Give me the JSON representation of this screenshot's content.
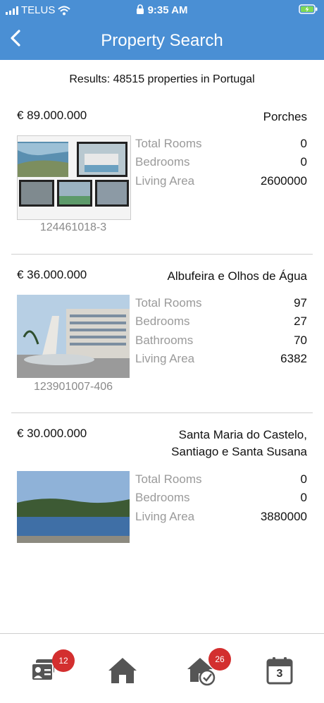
{
  "status": {
    "carrier": "TELUS",
    "time": "9:35 AM"
  },
  "header": {
    "title": "Property Search",
    "back_label": "<"
  },
  "results_text": "Results: 48515 properties in Portugal",
  "listings": [
    {
      "price": "€ 89.000.000",
      "location": "Porches",
      "ref": "124461018-3",
      "specs": [
        {
          "k": "Total Rooms",
          "v": "0"
        },
        {
          "k": "Bedrooms",
          "v": "0"
        },
        {
          "k": "Living Area",
          "v": "2600000"
        }
      ]
    },
    {
      "price": "€ 36.000.000",
      "location": "Albufeira e Olhos de Água",
      "ref": "123901007-406",
      "specs": [
        {
          "k": "Total Rooms",
          "v": "97"
        },
        {
          "k": "Bedrooms",
          "v": "27"
        },
        {
          "k": "Bathrooms",
          "v": "70"
        },
        {
          "k": "Living Area",
          "v": "6382"
        }
      ]
    },
    {
      "price": "€ 30.000.000",
      "location_line1": "Santa Maria do Castelo,",
      "location_line2": "Santiago e Santa Susana",
      "specs": [
        {
          "k": "Total Rooms",
          "v": "0"
        },
        {
          "k": "Bedrooms",
          "v": "0"
        },
        {
          "k": "Living Area",
          "v": "3880000"
        }
      ]
    }
  ],
  "tabbar": {
    "contacts_badge": "12",
    "favorites_badge": "26",
    "calendar_day": "3"
  },
  "colors": {
    "header": "#4a8fd4",
    "badge": "#d32f2f",
    "icon": "#555555"
  }
}
